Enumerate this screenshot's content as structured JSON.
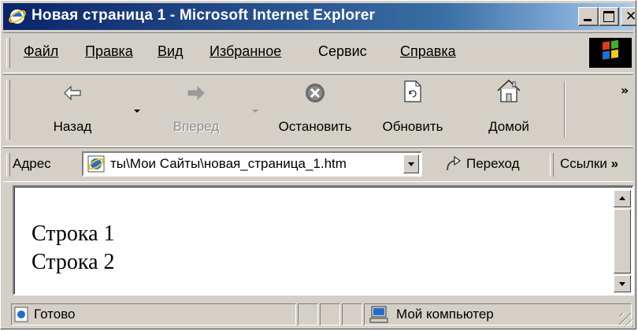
{
  "window": {
    "title": "Новая страница 1 - Microsoft Internet Explorer"
  },
  "menu": [
    {
      "label": "Файл"
    },
    {
      "label": "Правка"
    },
    {
      "label": "Вид"
    },
    {
      "label": "Избранное"
    },
    {
      "label": "Сервис"
    },
    {
      "label": "Справка"
    }
  ],
  "toolbar": {
    "back": {
      "label": "Назад",
      "icon": "arrow-left-icon"
    },
    "forward": {
      "label": "Вперед",
      "icon": "arrow-right-icon",
      "disabled": true
    },
    "stop": {
      "label": "Остановить",
      "icon": "stop-icon"
    },
    "refresh": {
      "label": "Обновить",
      "icon": "refresh-icon"
    },
    "home": {
      "label": "Домой",
      "icon": "home-icon"
    },
    "more": "»"
  },
  "address": {
    "label": "Адрес",
    "value": "ты\\Мои Сайты\\новая_страница_1.htm",
    "go_label": "Переход",
    "links_label": "Ссылки",
    "links_more": "»"
  },
  "page": {
    "lines": [
      "Строка 1",
      "Строка 2"
    ]
  },
  "status": {
    "text": "Готово",
    "zone": "Мой компьютер"
  },
  "colors": {
    "titlebar_start": "#0a246a",
    "titlebar_end": "#a6caf0",
    "chrome": "#d4d0c8"
  }
}
